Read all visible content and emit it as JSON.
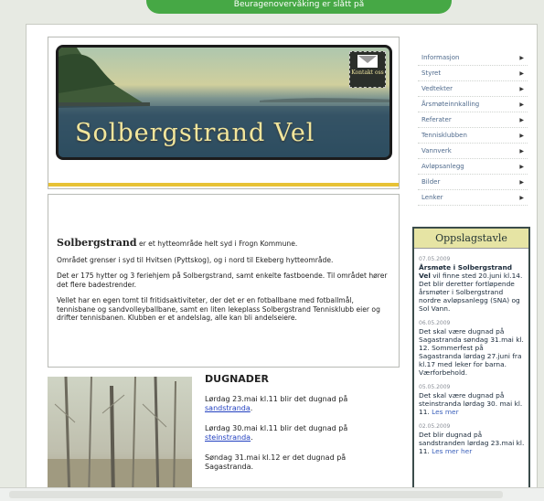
{
  "top_banner": {
    "text": "Beuragenovervåking er slått på"
  },
  "header": {
    "title": "Solbergstrand Vel",
    "contact_label": "Kontakt oss"
  },
  "menu": {
    "items": [
      {
        "label": "Informasjon"
      },
      {
        "label": "Styret"
      },
      {
        "label": "Vedtekter"
      },
      {
        "label": "Årsmøteinnkalling"
      },
      {
        "label": "Referater"
      },
      {
        "label": "Tennisklubben"
      },
      {
        "label": "Vannverk"
      },
      {
        "label": "Avløpsanlegg"
      },
      {
        "label": "Bilder"
      },
      {
        "label": "Lenker"
      }
    ],
    "arrow_icon": "chevron-right-icon"
  },
  "intro": {
    "lead_bold": "Solbergstrand",
    "lead_rest": " er et hytteområde helt syd i Frogn Kommune.",
    "p2": "Området grenser i syd til Hvitsen (Pyttskog), og i nord til Ekeberg hytteområde.",
    "p3": "Det er 175 hytter og 3 feriehjem på Solbergstrand, samt enkelte fastboende. Til området hører det flere badestrender.",
    "p4": "Vellet har en egen tomt til fritidsaktiviteter, der det er en fotballbane med fotballmål, tennisbane og sandvolleyballbane, samt en liten lekeplass Solbergstrand Tennisklubb eier og drifter tennisbanen. Klubben er et andelslag, alle kan bli andelseiere."
  },
  "dugnad": {
    "heading": "DUGNADER",
    "items": [
      {
        "text": "Lørdag 23.mai kl.11 blir det dugnad på ",
        "link": "sandstranda",
        "tail": "."
      },
      {
        "text": "Lørdag 30.mai kl.11 blir det dugnad på ",
        "link": "steinstranda",
        "tail": "."
      },
      {
        "text": "Søndag 31.mai kl.12 er det dugnad på Sagastranda.",
        "link": "",
        "tail": ""
      }
    ]
  },
  "board": {
    "title": "Oppslagstavle",
    "items": [
      {
        "date": "07.05.2009",
        "bold": "Årsmøte i Solbergstrand Vel",
        "text": " vil finne sted 20.juni kl.14. Det blir deretter fortløpende årsmøter i Solbergstrand nordre avløpsanlegg (SNA) og Sol Vann.",
        "link": ""
      },
      {
        "date": "06.05.2009",
        "bold": "",
        "text": "Det skal være dugnad på Sagastranda søndag 31.mai kl. 12. Sommerfest på Sagastranda lørdag 27.juni fra kl.17 med leker for barna. Værforbehold.",
        "link": ""
      },
      {
        "date": "05.05.2009",
        "bold": "",
        "text": "Det skal være dugnad på steinstranda lørdag 30. mai kl. 11. ",
        "link": "Les mer"
      },
      {
        "date": "02.05.2009",
        "bold": "",
        "text": "Det blir dugnad på sandstranden lørdag 23.mai kl. 11. ",
        "link": "Les mer her"
      }
    ]
  },
  "colors": {
    "accent_gold": "#e7c235",
    "menu_text": "#4f6a8c",
    "link": "#2240c0",
    "banner_green": "#46a845"
  }
}
